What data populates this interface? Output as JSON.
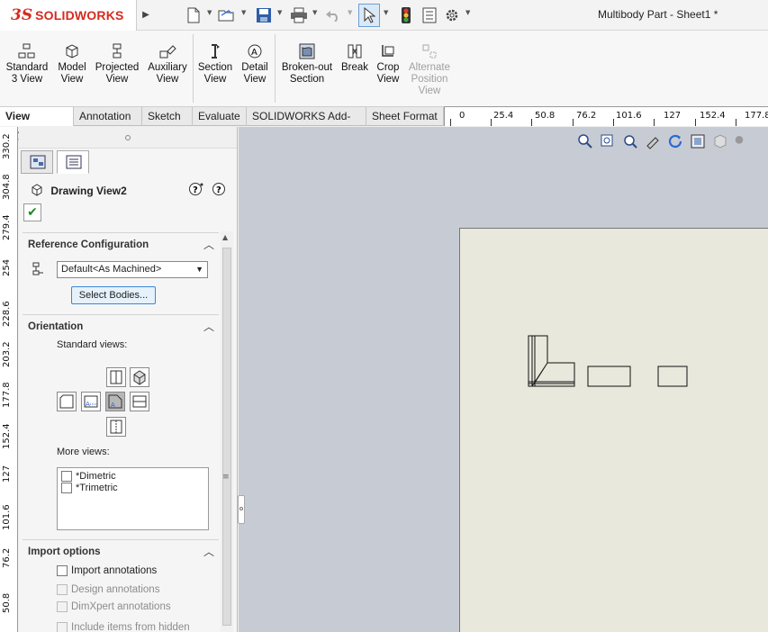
{
  "app": {
    "logo_ds": "3S",
    "brand": "SOLIDWORKS",
    "title": "Multibody Part - Sheet1 *"
  },
  "toolbar": {
    "icons": [
      "new-document-icon",
      "open-folder-icon",
      "save-icon",
      "print-icon",
      "undo-icon",
      "select-arrow-icon",
      "traffic-light-icon",
      "file-properties-icon",
      "options-gear-icon"
    ]
  },
  "ribbon": {
    "buttons": [
      {
        "label": "Standard\n3 View",
        "line1": "Standard",
        "line2": "3 View"
      },
      {
        "line1": "Model",
        "line2": "View"
      },
      {
        "line1": "Projected",
        "line2": "View"
      },
      {
        "line1": "Auxiliary",
        "line2": "View"
      },
      {
        "line1": "Section",
        "line2": "View"
      },
      {
        "line1": "Detail",
        "line2": "View"
      },
      {
        "line1": "Broken-out",
        "line2": "Section"
      },
      {
        "line1": "Break",
        "line2": ""
      },
      {
        "line1": "Crop",
        "line2": "View"
      },
      {
        "line1": "Alternate",
        "line2": "Position",
        "line3": "View",
        "disabled": true
      }
    ]
  },
  "tabs": [
    "View Layout",
    "Annotation",
    "Sketch",
    "Evaluate",
    "SOLIDWORKS Add-Ins",
    "Sheet Format"
  ],
  "hruler": [
    "0",
    "25.4",
    "50.8",
    "76.2",
    "101.6",
    "127",
    "152.4",
    "177.8"
  ],
  "vruler": [
    "330.2",
    "304.8",
    "279.4",
    "254",
    "228.6",
    "203.2",
    "177.8",
    "152.4",
    "127",
    "101.6",
    "76.2",
    "50.8"
  ],
  "panel": {
    "title": "Drawing View2",
    "ref_config": {
      "header": "Reference Configuration",
      "selected": "Default<As Machined>",
      "button": "Select Bodies..."
    },
    "orientation": {
      "header": "Orientation",
      "standard_views_label": "Standard views:",
      "more_views_label": "More views:",
      "more_views": [
        "*Dimetric",
        "*Trimetric"
      ]
    },
    "import_options": {
      "header": "Import options",
      "items": [
        {
          "label": "Import annotations",
          "enabled": true
        },
        {
          "label": "Design annotations",
          "enabled": false
        },
        {
          "label": "DimXpert annotations",
          "enabled": false
        },
        {
          "label": "Include items from hidden",
          "enabled": false
        }
      ]
    }
  },
  "colors": {
    "brand_red": "#d52b1e",
    "canvas_bg": "#c7cbd4",
    "sheet_bg": "#e8e8dc",
    "ok_green": "#1f8b1f",
    "button_border": "#3b87d8"
  }
}
